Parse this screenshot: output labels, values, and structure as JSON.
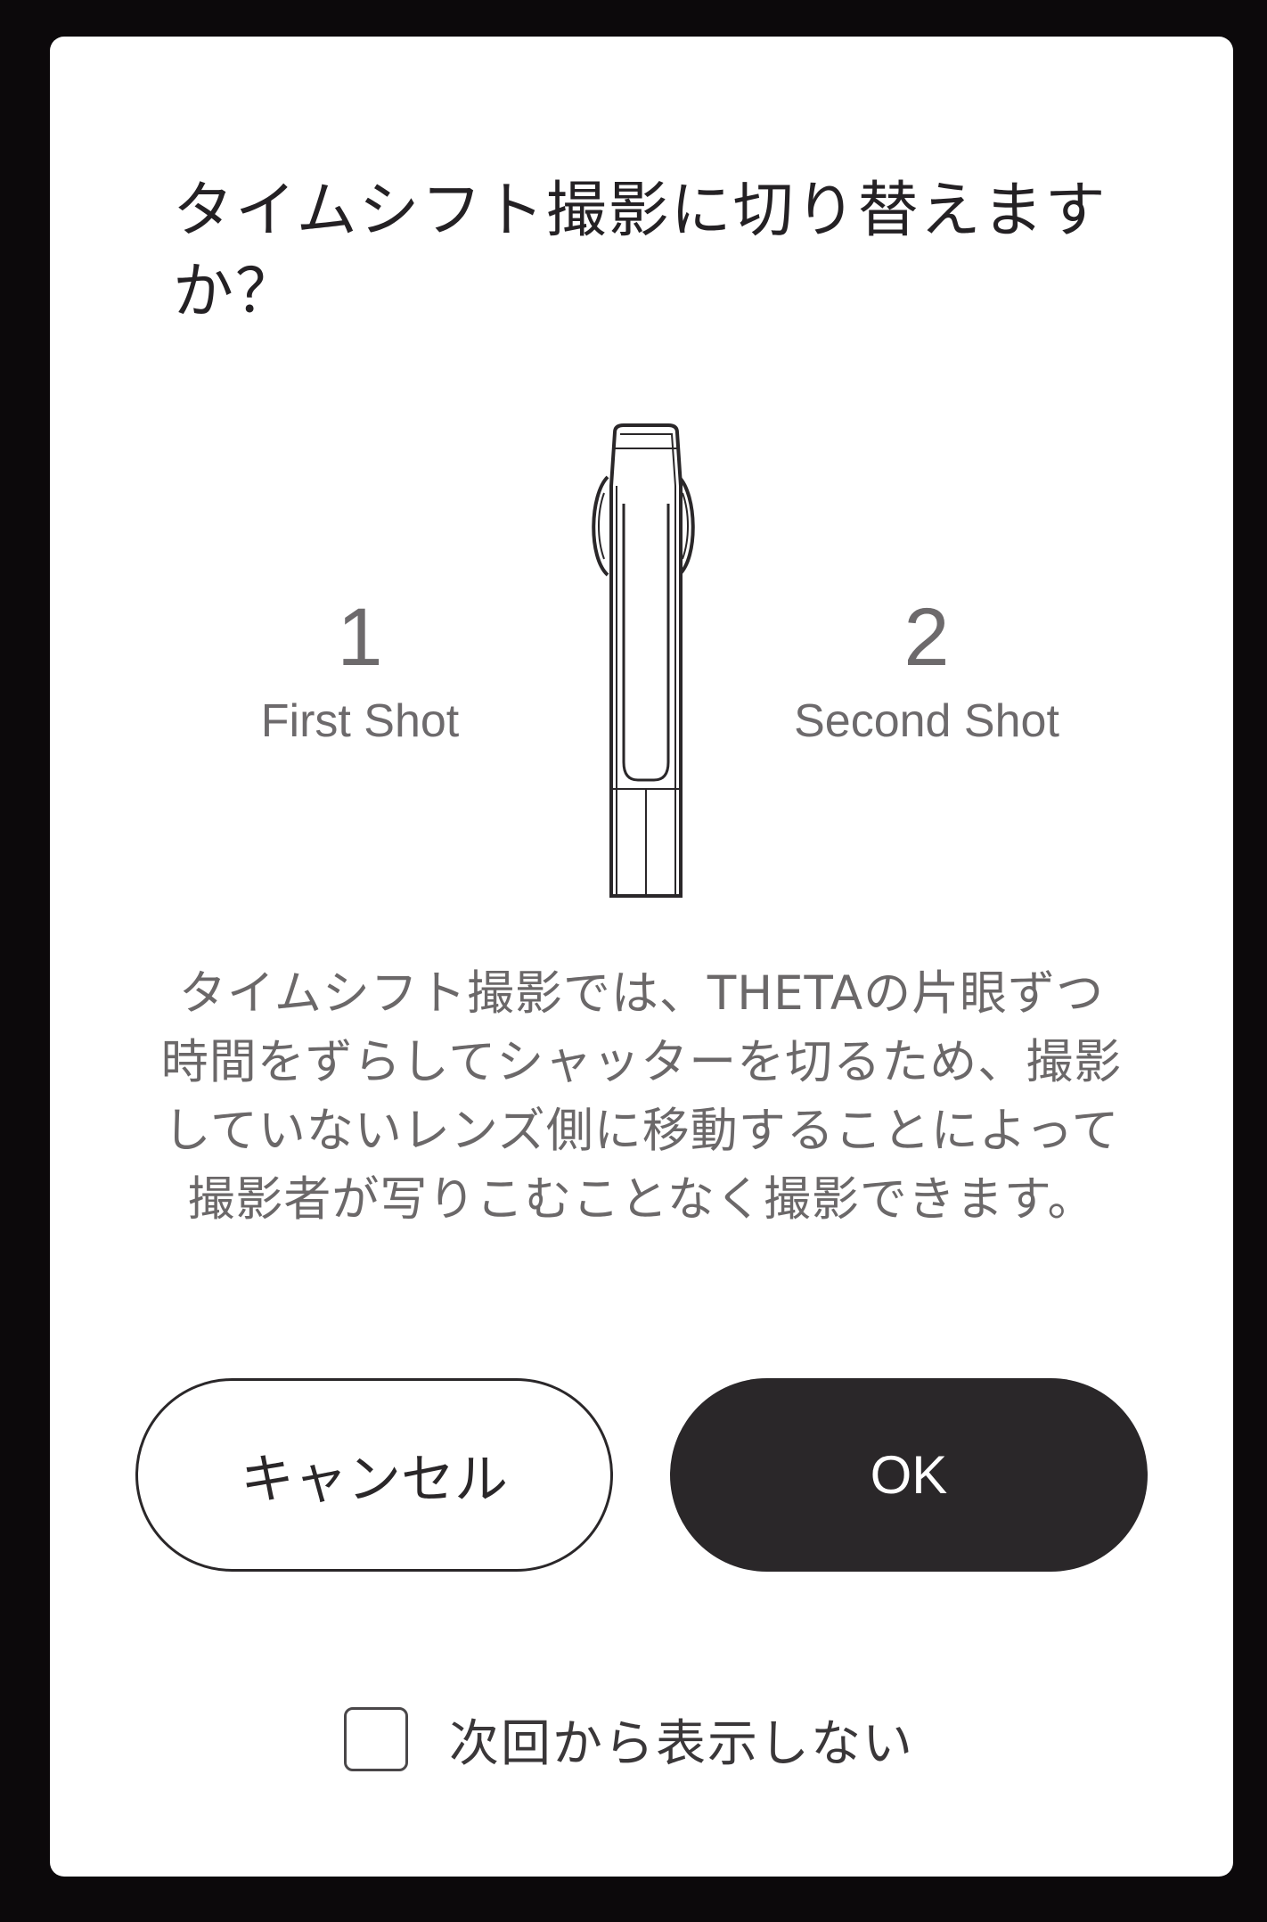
{
  "dialog": {
    "title": "タイムシフト撮影に切り替えますか？",
    "first_shot": {
      "number": "1",
      "label": "First Shot"
    },
    "second_shot": {
      "number": "2",
      "label": "Second Shot"
    },
    "description": "タイムシフト撮影では、THETAの片眼ずつ時間をずらしてシャッターを切るため、撮影していないレンズ側に移動することによって撮影者が写りこむことなく撮影できます。",
    "cancel_label": "キャンセル",
    "ok_label": "OK",
    "dont_show_again_label": "次回から表示しない",
    "dont_show_again_checked": false
  }
}
